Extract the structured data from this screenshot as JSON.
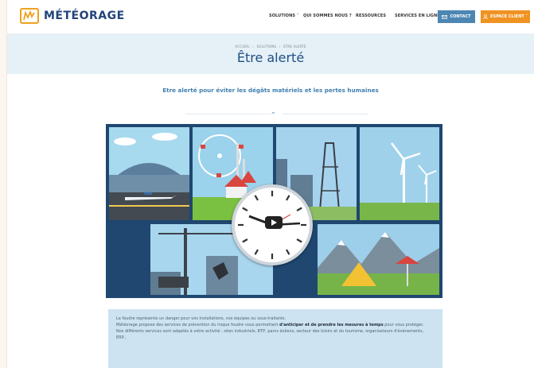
{
  "header": {
    "logo_text": "MÉTÉORAGE",
    "nav": [
      "SOLUTIONS ˅",
      "QUI SOMMES NOUS ?",
      "RESSOURCES",
      "SERVICES EN LIGNE"
    ],
    "contact_label": "CONTACT",
    "client_label": "ESPACE CLIENT ˅"
  },
  "hero": {
    "breadcrumb": [
      "ACCUEIL",
      "SOLUTIONS",
      "ETRE ALERTÉ"
    ],
    "title": "Être alerté"
  },
  "subtitle": "Etre alerté pour éviter les dégâts matériels et les pertes humaines",
  "info": {
    "line1": "La foudre représente un danger pour vos installations, vos équipes ou sous-traitants.",
    "line2_start": "Météorage propose des services de prévention du risque foudre vous permettant ",
    "line2_bold": "d'anticiper et de prendre les mesures à temps",
    "line2_end": " pour vous protéger.",
    "line3": "Nos différents services sont adaptés à votre activité : sites industriels, BTP, parcs éoliens, secteur des loisirs et du tourisme, organisateurs d'évènements, ERP..."
  },
  "colors": {
    "brand_blue": "#1f4f83",
    "accent_orange": "#ef9322",
    "contact_blue": "#4c86b2",
    "hero_bg": "#e5f0f7",
    "info_bg": "#cde3f1"
  }
}
